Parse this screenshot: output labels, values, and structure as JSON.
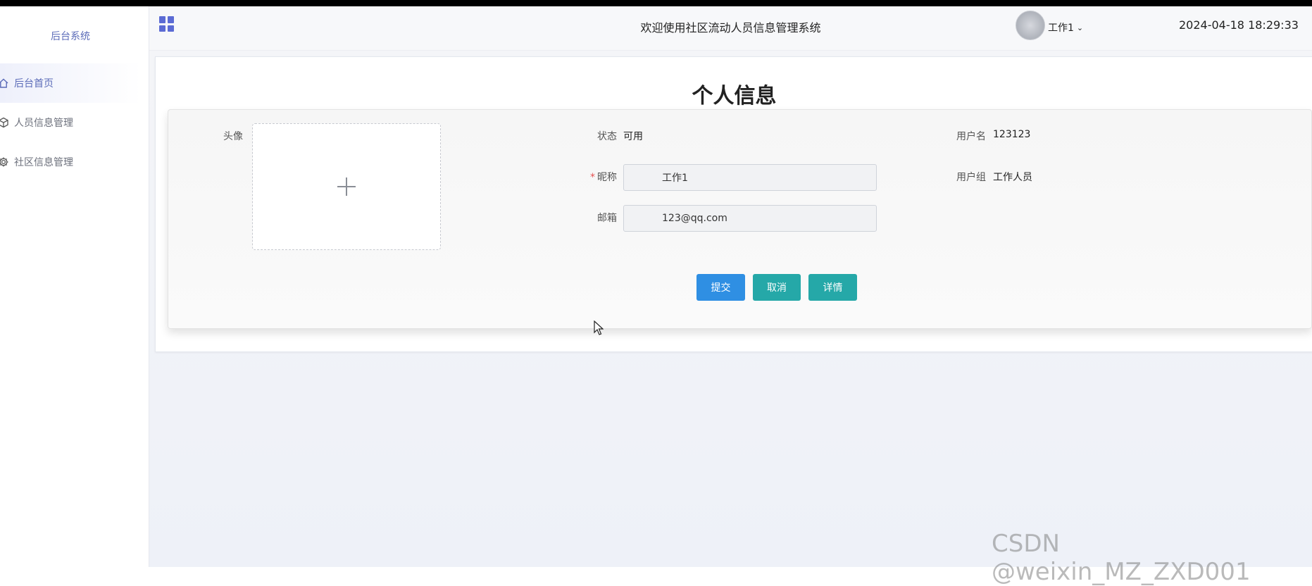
{
  "sidebar": {
    "brand": "后台系统",
    "items": [
      {
        "label": "后台首页",
        "icon": "home-icon",
        "active": true
      },
      {
        "label": "人员信息管理",
        "icon": "cube-icon",
        "active": false
      },
      {
        "label": "社区信息管理",
        "icon": "gear-icon",
        "active": false
      }
    ]
  },
  "header": {
    "title": "欢迎使用社区流动人员信息管理系统",
    "user": "工作1",
    "datetime": "2024-04-18 18:29:33"
  },
  "page": {
    "title": "个人信息",
    "avatar_label": "头像",
    "status_label": "状态",
    "status_value": "可用",
    "nickname_label": "昵称",
    "nickname_value": "工作1",
    "email_label": "邮箱",
    "email_value": "123@qq.com",
    "username_label": "用户名",
    "username_value": "123123",
    "group_label": "用户组",
    "group_value": "工作人员",
    "buttons": {
      "submit": "提交",
      "cancel": "取消",
      "detail": "详情"
    }
  },
  "watermark": "CSDN @weixin_MZ_ZXD001",
  "colors": {
    "primary": "#2f8fe3",
    "teal": "#25a8a8",
    "accent": "#5b6bd4"
  }
}
